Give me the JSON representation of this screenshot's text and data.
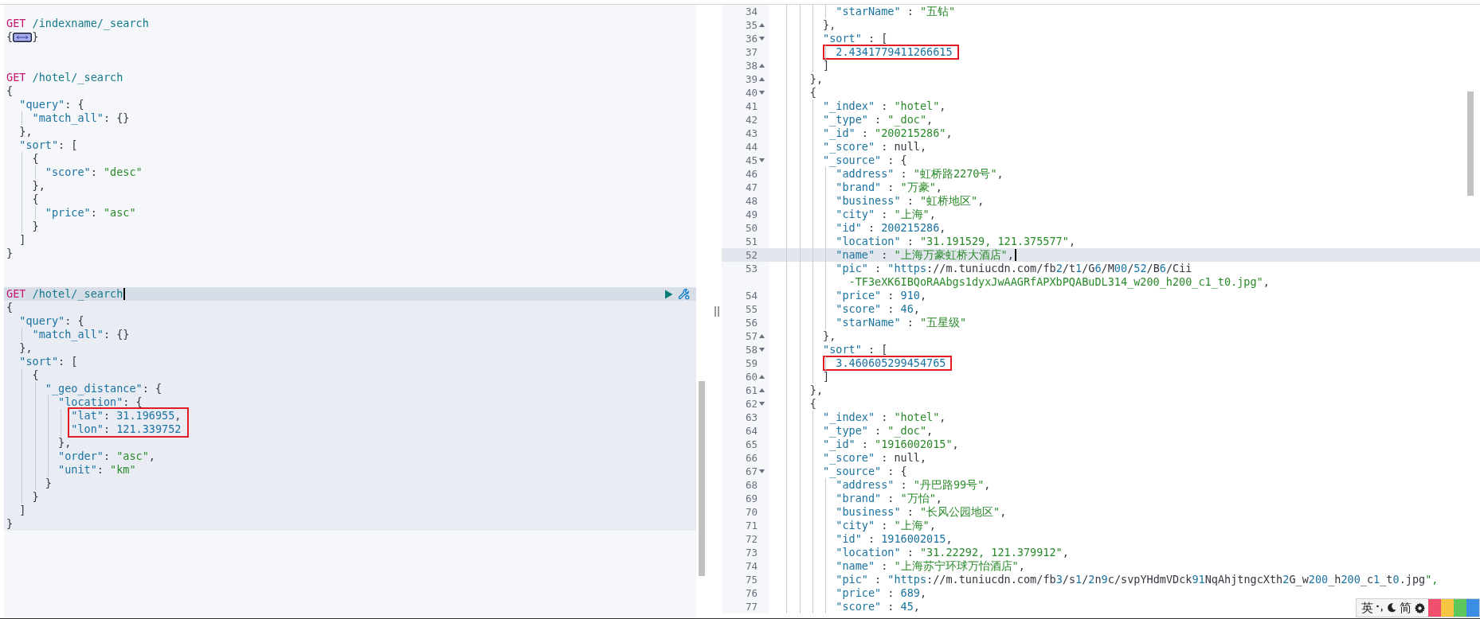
{
  "requests": [
    {
      "selected": false,
      "method": "GET",
      "path": "/indexname/_search",
      "body": [
        {
          "kind": "collapsed",
          "open": "{",
          "close": "}"
        }
      ]
    },
    {
      "selected": false,
      "method": "GET",
      "path": "/hotel/_search",
      "body": [
        {
          "kind": "code",
          "text": "{"
        },
        {
          "kind": "code",
          "text": "  \"query\": {"
        },
        {
          "kind": "code",
          "text": "    \"match_all\": {}"
        },
        {
          "kind": "code",
          "text": "  },"
        },
        {
          "kind": "code",
          "text": "  \"sort\": ["
        },
        {
          "kind": "code",
          "text": "    {"
        },
        {
          "kind": "code",
          "text": "      \"score\": \"desc\""
        },
        {
          "kind": "code",
          "text": "    },"
        },
        {
          "kind": "code",
          "text": "    {"
        },
        {
          "kind": "code",
          "text": "      \"price\": \"asc\""
        },
        {
          "kind": "code",
          "text": "    }"
        },
        {
          "kind": "code",
          "text": "  ]"
        },
        {
          "kind": "code",
          "text": "}"
        }
      ]
    },
    {
      "selected": true,
      "method": "GET",
      "path": "/hotel/_search",
      "body": [
        {
          "kind": "code",
          "text": "{"
        },
        {
          "kind": "code",
          "text": "  \"query\": {"
        },
        {
          "kind": "code",
          "text": "    \"match_all\": {}"
        },
        {
          "kind": "code",
          "text": "  },"
        },
        {
          "kind": "code",
          "text": "  \"sort\": ["
        },
        {
          "kind": "code",
          "text": "    {"
        },
        {
          "kind": "code",
          "text": "      \"_geo_distance\": {"
        },
        {
          "kind": "code",
          "text": "        \"location\": {"
        },
        {
          "kind": "box",
          "lines": [
            {
              "kind": "code",
              "text": "          \"lat\": 31.196955,"
            },
            {
              "kind": "code",
              "text": "          \"lon\": 121.339752"
            }
          ]
        },
        {
          "kind": "code",
          "text": "        },"
        },
        {
          "kind": "code",
          "text": "        \"order\": \"asc\","
        },
        {
          "kind": "code",
          "text": "        \"unit\": \"km\""
        },
        {
          "kind": "code",
          "text": "      }"
        },
        {
          "kind": "code",
          "text": "    }"
        },
        {
          "kind": "code",
          "text": "  ]"
        },
        {
          "kind": "code",
          "text": "}"
        }
      ]
    }
  ],
  "response": [
    {
      "kind": "code",
      "n": "34",
      "region_start": false,
      "region_end": false,
      "active": false,
      "text": "          \"starName\" : \"五钻\""
    },
    {
      "kind": "code",
      "n": "35",
      "region_start": false,
      "region_end": true,
      "active": false,
      "text": "        },"
    },
    {
      "kind": "code",
      "n": "36",
      "region_start": true,
      "region_end": false,
      "active": false,
      "text": "        \"sort\" : ["
    },
    {
      "kind": "box",
      "lines": [
        {
          "kind": "code",
          "n": "37",
          "region_start": false,
          "region_end": false,
          "active": false,
          "text": "          2.4341779411266615"
        }
      ]
    },
    {
      "kind": "code",
      "n": "38",
      "region_start": false,
      "region_end": true,
      "active": false,
      "text": "        ]"
    },
    {
      "kind": "code",
      "n": "39",
      "region_start": false,
      "region_end": true,
      "active": false,
      "text": "      },"
    },
    {
      "kind": "code",
      "n": "40",
      "region_start": true,
      "region_end": false,
      "active": false,
      "text": "      {"
    },
    {
      "kind": "code",
      "n": "41",
      "region_start": false,
      "region_end": false,
      "active": false,
      "text": "        \"_index\" : \"hotel\","
    },
    {
      "kind": "code",
      "n": "42",
      "region_start": false,
      "region_end": false,
      "active": false,
      "text": "        \"_type\" : \"_doc\","
    },
    {
      "kind": "code",
      "n": "43",
      "region_start": false,
      "region_end": false,
      "active": false,
      "text": "        \"_id\" : \"200215286\","
    },
    {
      "kind": "code",
      "n": "44",
      "region_start": false,
      "region_end": false,
      "active": false,
      "text": "        \"_score\" : null,"
    },
    {
      "kind": "code",
      "n": "45",
      "region_start": true,
      "region_end": false,
      "active": false,
      "text": "        \"_source\" : {"
    },
    {
      "kind": "code",
      "n": "46",
      "region_start": false,
      "region_end": false,
      "active": false,
      "text": "          \"address\" : \"虹桥路2270号\","
    },
    {
      "kind": "code",
      "n": "47",
      "region_start": false,
      "region_end": false,
      "active": false,
      "text": "          \"brand\" : \"万豪\","
    },
    {
      "kind": "code",
      "n": "48",
      "region_start": false,
      "region_end": false,
      "active": false,
      "text": "          \"business\" : \"虹桥地区\","
    },
    {
      "kind": "code",
      "n": "49",
      "region_start": false,
      "region_end": false,
      "active": false,
      "text": "          \"city\" : \"上海\","
    },
    {
      "kind": "code",
      "n": "50",
      "region_start": false,
      "region_end": false,
      "active": false,
      "text": "          \"id\" : 200215286,"
    },
    {
      "kind": "code",
      "n": "51",
      "region_start": false,
      "region_end": false,
      "active": false,
      "text": "          \"location\" : \"31.191529, 121.375577\","
    },
    {
      "kind": "code",
      "n": "52",
      "region_start": false,
      "region_end": false,
      "active": true,
      "text": "          \"name\" : \"上海万豪虹桥大酒店\","
    },
    {
      "kind": "code",
      "n": "53",
      "region_start": false,
      "region_end": false,
      "active": false,
      "text": "          \"pic\" : \"https://m.tuniucdn.com/fb2/t1/G6/M00/52/B6/Cii",
      "wrapped": "-TF3eXK6IBQoRAAbgs1dyxJwAAGRfAPXbPQABuDL314_w200_h200_c1_t0.jpg\","
    },
    {
      "kind": "code",
      "n": "54",
      "region_start": false,
      "region_end": false,
      "active": false,
      "text": "          \"price\" : 910,"
    },
    {
      "kind": "code",
      "n": "55",
      "region_start": false,
      "region_end": false,
      "active": false,
      "text": "          \"score\" : 46,"
    },
    {
      "kind": "code",
      "n": "56",
      "region_start": false,
      "region_end": false,
      "active": false,
      "text": "          \"starName\" : \"五星级\""
    },
    {
      "kind": "code",
      "n": "57",
      "region_start": false,
      "region_end": true,
      "active": false,
      "text": "        },"
    },
    {
      "kind": "code",
      "n": "58",
      "region_start": true,
      "region_end": false,
      "active": false,
      "text": "        \"sort\" : ["
    },
    {
      "kind": "box",
      "lines": [
        {
          "kind": "code",
          "n": "59",
          "region_start": false,
          "region_end": false,
          "active": false,
          "text": "          3.460605299454765"
        }
      ]
    },
    {
      "kind": "code",
      "n": "60",
      "region_start": false,
      "region_end": true,
      "active": false,
      "text": "        ]"
    },
    {
      "kind": "code",
      "n": "61",
      "region_start": false,
      "region_end": true,
      "active": false,
      "text": "      },"
    },
    {
      "kind": "code",
      "n": "62",
      "region_start": true,
      "region_end": false,
      "active": false,
      "text": "      {"
    },
    {
      "kind": "code",
      "n": "63",
      "region_start": false,
      "region_end": false,
      "active": false,
      "text": "        \"_index\" : \"hotel\","
    },
    {
      "kind": "code",
      "n": "64",
      "region_start": false,
      "region_end": false,
      "active": false,
      "text": "        \"_type\" : \"_doc\","
    },
    {
      "kind": "code",
      "n": "65",
      "region_start": false,
      "region_end": false,
      "active": false,
      "text": "        \"_id\" : \"1916002015\","
    },
    {
      "kind": "code",
      "n": "66",
      "region_start": false,
      "region_end": false,
      "active": false,
      "text": "        \"_score\" : null,"
    },
    {
      "kind": "code",
      "n": "67",
      "region_start": true,
      "region_end": false,
      "active": false,
      "text": "        \"_source\" : {"
    },
    {
      "kind": "code",
      "n": "68",
      "region_start": false,
      "region_end": false,
      "active": false,
      "text": "          \"address\" : \"丹巴路99号\","
    },
    {
      "kind": "code",
      "n": "69",
      "region_start": false,
      "region_end": false,
      "active": false,
      "text": "          \"brand\" : \"万怡\","
    },
    {
      "kind": "code",
      "n": "70",
      "region_start": false,
      "region_end": false,
      "active": false,
      "text": "          \"business\" : \"长风公园地区\","
    },
    {
      "kind": "code",
      "n": "71",
      "region_start": false,
      "region_end": false,
      "active": false,
      "text": "          \"city\" : \"上海\","
    },
    {
      "kind": "code",
      "n": "72",
      "region_start": false,
      "region_end": false,
      "active": false,
      "text": "          \"id\" : 1916002015,"
    },
    {
      "kind": "code",
      "n": "73",
      "region_start": false,
      "region_end": false,
      "active": false,
      "text": "          \"location\" : \"31.22292, 121.379912\","
    },
    {
      "kind": "code",
      "n": "74",
      "region_start": false,
      "region_end": false,
      "active": false,
      "text": "          \"name\" : \"上海苏宁环球万怡酒店\","
    },
    {
      "kind": "code",
      "n": "75",
      "region_start": false,
      "region_end": false,
      "active": false,
      "text": "          \"pic\" : \"https://m.tuniucdn.com/fb3/s1/2n9c/svpYHdmVDck91NqAhjtngcXth2G_w200_h200_c1_t0.jpg\","
    },
    {
      "kind": "code",
      "n": "76",
      "region_start": false,
      "region_end": false,
      "active": false,
      "text": "          \"price\" : 689,"
    },
    {
      "kind": "code",
      "n": "77",
      "region_start": false,
      "region_end": false,
      "active": false,
      "text": "          \"score\" : 45,"
    }
  ],
  "ime": {
    "language": "英",
    "script": "简"
  }
}
